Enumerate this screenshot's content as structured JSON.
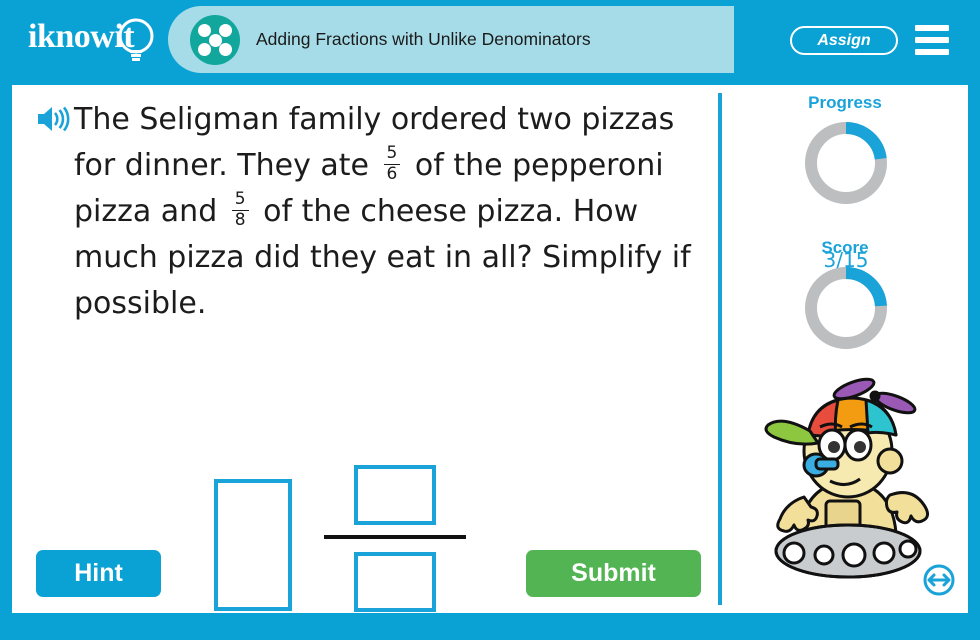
{
  "header": {
    "logo_text": "iknowit",
    "logo_icon": "lightbulb-icon",
    "title_icon": "five-dots-circle-icon",
    "title": "Adding Fractions with Unlike Denominators",
    "assign_label": "Assign",
    "menu_icon": "hamburger-menu-icon",
    "bg_color": "#0aa2d4",
    "pill_color": "#a6dce8",
    "icon_color": "#12a79d"
  },
  "question": {
    "audio_icon": "speaker-icon",
    "text_part1": "The Seligman family ordered two pizzas for dinner. They ate",
    "fraction1": {
      "numerator": "5",
      "denominator": "6"
    },
    "text_part2": "of the pepperoni pizza and",
    "fraction2": {
      "numerator": "5",
      "denominator": "8"
    },
    "text_part3": "of the cheese pizza. How much pizza did they eat in all? Simplify if possible."
  },
  "answer": {
    "whole_value": "",
    "whole_placeholder": "",
    "numerator_value": "",
    "numerator_placeholder": "",
    "denominator_value": "",
    "denominator_placeholder": "",
    "box_border_color": "#1aa3d8",
    "fraction_bar_color": "#111111"
  },
  "buttons": {
    "hint_label": "Hint",
    "hint_color": "#0aa2d4",
    "submit_label": "Submit",
    "submit_color": "#52b453"
  },
  "sidebar": {
    "progress_label": "Progress",
    "progress_value": "3/15",
    "progress_percent": 23,
    "score_label": "Score",
    "score_value": "3",
    "score_percent": 24,
    "track_color": "#bcbec0",
    "arc_color": "#1aa3d8",
    "mascot_name": "robot-mascot-propeller-hat",
    "resize_icon": "resize-horizontal-icon"
  }
}
